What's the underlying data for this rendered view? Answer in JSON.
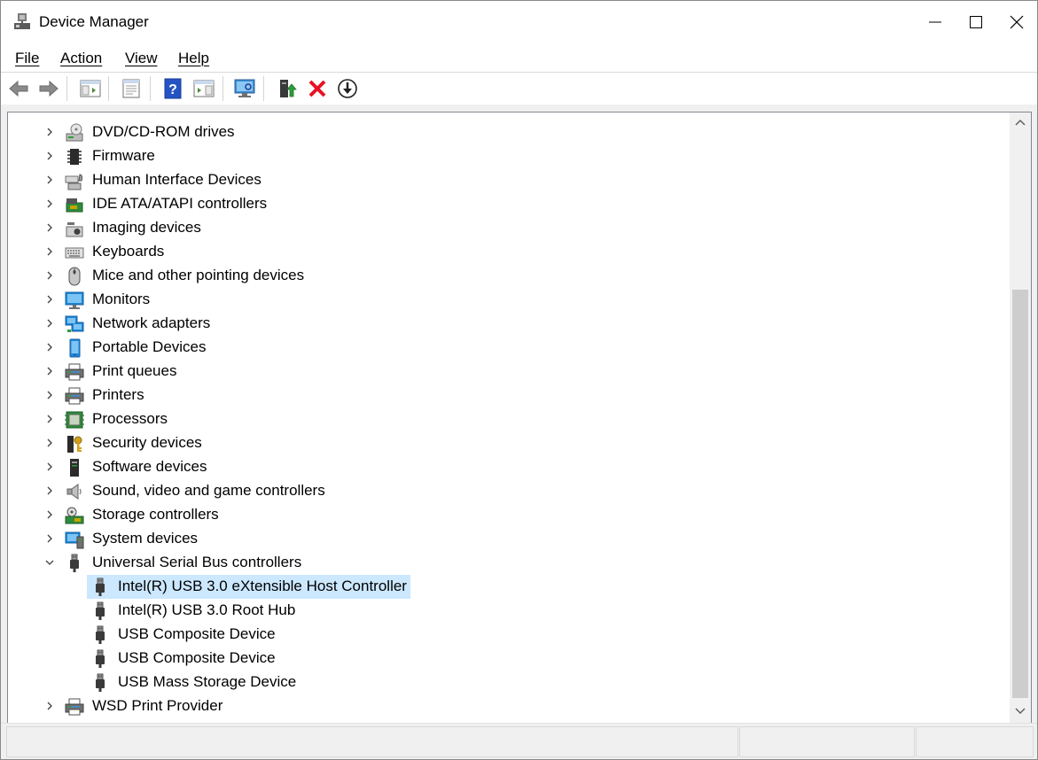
{
  "window": {
    "title": "Device Manager"
  },
  "menubar": {
    "items": [
      {
        "label": "File"
      },
      {
        "label": "Action"
      },
      {
        "label": "View"
      },
      {
        "label": "Help"
      }
    ]
  },
  "toolbar": {
    "buttons": [
      {
        "icon": "back-arrow-icon"
      },
      {
        "icon": "forward-arrow-icon"
      },
      {
        "icon": "show-hide-console-tree-icon"
      },
      {
        "icon": "properties-icon"
      },
      {
        "icon": "help-icon"
      },
      {
        "icon": "action-pane-icon"
      },
      {
        "icon": "scan-hardware-changes-icon"
      },
      {
        "icon": "update-driver-icon"
      },
      {
        "icon": "uninstall-device-icon"
      },
      {
        "icon": "disable-device-icon"
      }
    ]
  },
  "tree": {
    "categories": [
      {
        "label": "DVD/CD-ROM drives",
        "icon": "dvd-drive-icon",
        "expanded": false
      },
      {
        "label": "Firmware",
        "icon": "firmware-chip-icon",
        "expanded": false
      },
      {
        "label": "Human Interface Devices",
        "icon": "hid-icon",
        "expanded": false
      },
      {
        "label": "IDE ATA/ATAPI controllers",
        "icon": "ide-controller-icon",
        "expanded": false
      },
      {
        "label": "Imaging devices",
        "icon": "camera-icon",
        "expanded": false
      },
      {
        "label": "Keyboards",
        "icon": "keyboard-icon",
        "expanded": false
      },
      {
        "label": "Mice and other pointing devices",
        "icon": "mouse-icon",
        "expanded": false
      },
      {
        "label": "Monitors",
        "icon": "monitor-icon",
        "expanded": false
      },
      {
        "label": "Network adapters",
        "icon": "network-adapter-icon",
        "expanded": false
      },
      {
        "label": "Portable Devices",
        "icon": "portable-device-icon",
        "expanded": false
      },
      {
        "label": "Print queues",
        "icon": "printer-icon",
        "expanded": false
      },
      {
        "label": "Printers",
        "icon": "printer-icon",
        "expanded": false
      },
      {
        "label": "Processors",
        "icon": "processor-icon",
        "expanded": false
      },
      {
        "label": "Security devices",
        "icon": "security-key-icon",
        "expanded": false
      },
      {
        "label": "Software devices",
        "icon": "software-device-icon",
        "expanded": false
      },
      {
        "label": "Sound, video and game controllers",
        "icon": "speaker-icon",
        "expanded": false
      },
      {
        "label": "Storage controllers",
        "icon": "storage-controller-icon",
        "expanded": false
      },
      {
        "label": "System devices",
        "icon": "system-devices-icon",
        "expanded": false
      },
      {
        "label": "Universal Serial Bus controllers",
        "icon": "usb-plug-icon",
        "expanded": true,
        "children": [
          {
            "label": "Intel(R) USB 3.0 eXtensible Host Controller",
            "icon": "usb-plug-icon",
            "selected": true
          },
          {
            "label": "Intel(R) USB 3.0 Root Hub",
            "icon": "usb-plug-icon",
            "selected": false
          },
          {
            "label": "USB Composite Device",
            "icon": "usb-plug-icon",
            "selected": false
          },
          {
            "label": "USB Composite Device",
            "icon": "usb-plug-icon",
            "selected": false
          },
          {
            "label": "USB Mass Storage Device",
            "icon": "usb-plug-icon",
            "selected": false
          }
        ]
      },
      {
        "label": "WSD Print Provider",
        "icon": "printer-icon",
        "expanded": false
      }
    ]
  },
  "colors": {
    "selection": "#cce8ff",
    "uninstall_red": "#e81123",
    "update_green": "#2e9e3a",
    "help_blue": "#2553c4"
  }
}
